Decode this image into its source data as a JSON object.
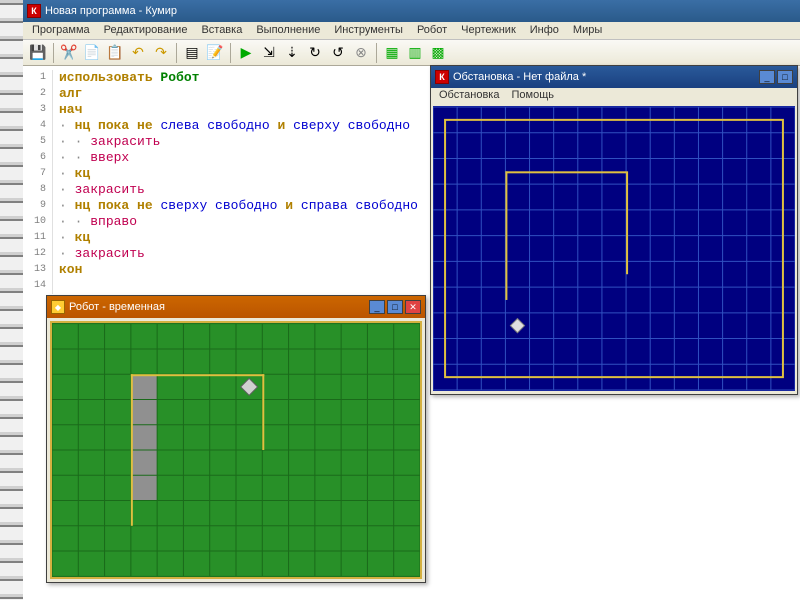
{
  "main": {
    "title": "Новая программа - Кумир",
    "menus": [
      "Программа",
      "Редактирование",
      "Вставка",
      "Выполнение",
      "Инструменты",
      "Робот",
      "Чертежник",
      "Инфо",
      "Миры"
    ]
  },
  "code": {
    "lines": [
      {
        "n": 1,
        "tokens": [
          {
            "t": "использовать ",
            "c": "kw"
          },
          {
            "t": "Робот",
            "c": "name"
          }
        ]
      },
      {
        "n": 2,
        "tokens": [
          {
            "t": "алг",
            "c": "kw"
          }
        ]
      },
      {
        "n": 3,
        "tokens": [
          {
            "t": "нач",
            "c": "kw"
          }
        ]
      },
      {
        "n": 4,
        "tokens": [
          {
            "t": "· ",
            "c": "dot"
          },
          {
            "t": "нц пока не",
            "c": "kw"
          },
          {
            "t": " ",
            "c": ""
          },
          {
            "t": "слева свободно",
            "c": "cond"
          },
          {
            "t": " ",
            "c": ""
          },
          {
            "t": "и",
            "c": "kw"
          },
          {
            "t": " ",
            "c": ""
          },
          {
            "t": "сверху свободно",
            "c": "cond"
          }
        ]
      },
      {
        "n": 5,
        "tokens": [
          {
            "t": "· · ",
            "c": "dot"
          },
          {
            "t": "закрасить",
            "c": "cmd"
          }
        ]
      },
      {
        "n": 6,
        "tokens": [
          {
            "t": "· · ",
            "c": "dot"
          },
          {
            "t": "вверх",
            "c": "cmd"
          }
        ]
      },
      {
        "n": 7,
        "tokens": [
          {
            "t": "· ",
            "c": "dot"
          },
          {
            "t": "кц",
            "c": "kw"
          }
        ]
      },
      {
        "n": 8,
        "tokens": [
          {
            "t": "· ",
            "c": "dot"
          },
          {
            "t": "закрасить",
            "c": "cmd"
          }
        ]
      },
      {
        "n": 9,
        "tokens": [
          {
            "t": "· ",
            "c": "dot"
          },
          {
            "t": "нц пока не",
            "c": "kw"
          },
          {
            "t": " ",
            "c": ""
          },
          {
            "t": "сверху свободно",
            "c": "cond"
          },
          {
            "t": " ",
            "c": ""
          },
          {
            "t": "и",
            "c": "kw"
          },
          {
            "t": " ",
            "c": ""
          },
          {
            "t": "справа свободно",
            "c": "cond"
          }
        ]
      },
      {
        "n": 10,
        "tokens": [
          {
            "t": "· · ",
            "c": "dot"
          },
          {
            "t": "вправо",
            "c": "cmd"
          }
        ]
      },
      {
        "n": 11,
        "tokens": [
          {
            "t": "· ",
            "c": "dot"
          },
          {
            "t": "кц",
            "c": "kw"
          }
        ]
      },
      {
        "n": 12,
        "tokens": [
          {
            "t": "· ",
            "c": "dot"
          },
          {
            "t": "закрасить",
            "c": "cmd"
          }
        ]
      },
      {
        "n": 13,
        "tokens": [
          {
            "t": "кон",
            "c": "kw"
          }
        ]
      },
      {
        "n": 14,
        "tokens": [
          {
            "t": "",
            "c": ""
          }
        ]
      }
    ]
  },
  "robot_window": {
    "title": "Робот - временная",
    "grid": {
      "cols": 14,
      "rows": 10,
      "greyCells": [
        [
          3,
          2
        ],
        [
          3,
          3
        ],
        [
          3,
          4
        ],
        [
          3,
          5
        ],
        [
          3,
          6
        ]
      ],
      "robot": [
        7,
        2
      ]
    }
  },
  "obs_window": {
    "title": "Обстановка - Нет файла *",
    "menus": [
      "Обстановка",
      "Помощь"
    ],
    "grid": {
      "cols": 15,
      "rows": 11,
      "robot": [
        3,
        8
      ]
    }
  }
}
